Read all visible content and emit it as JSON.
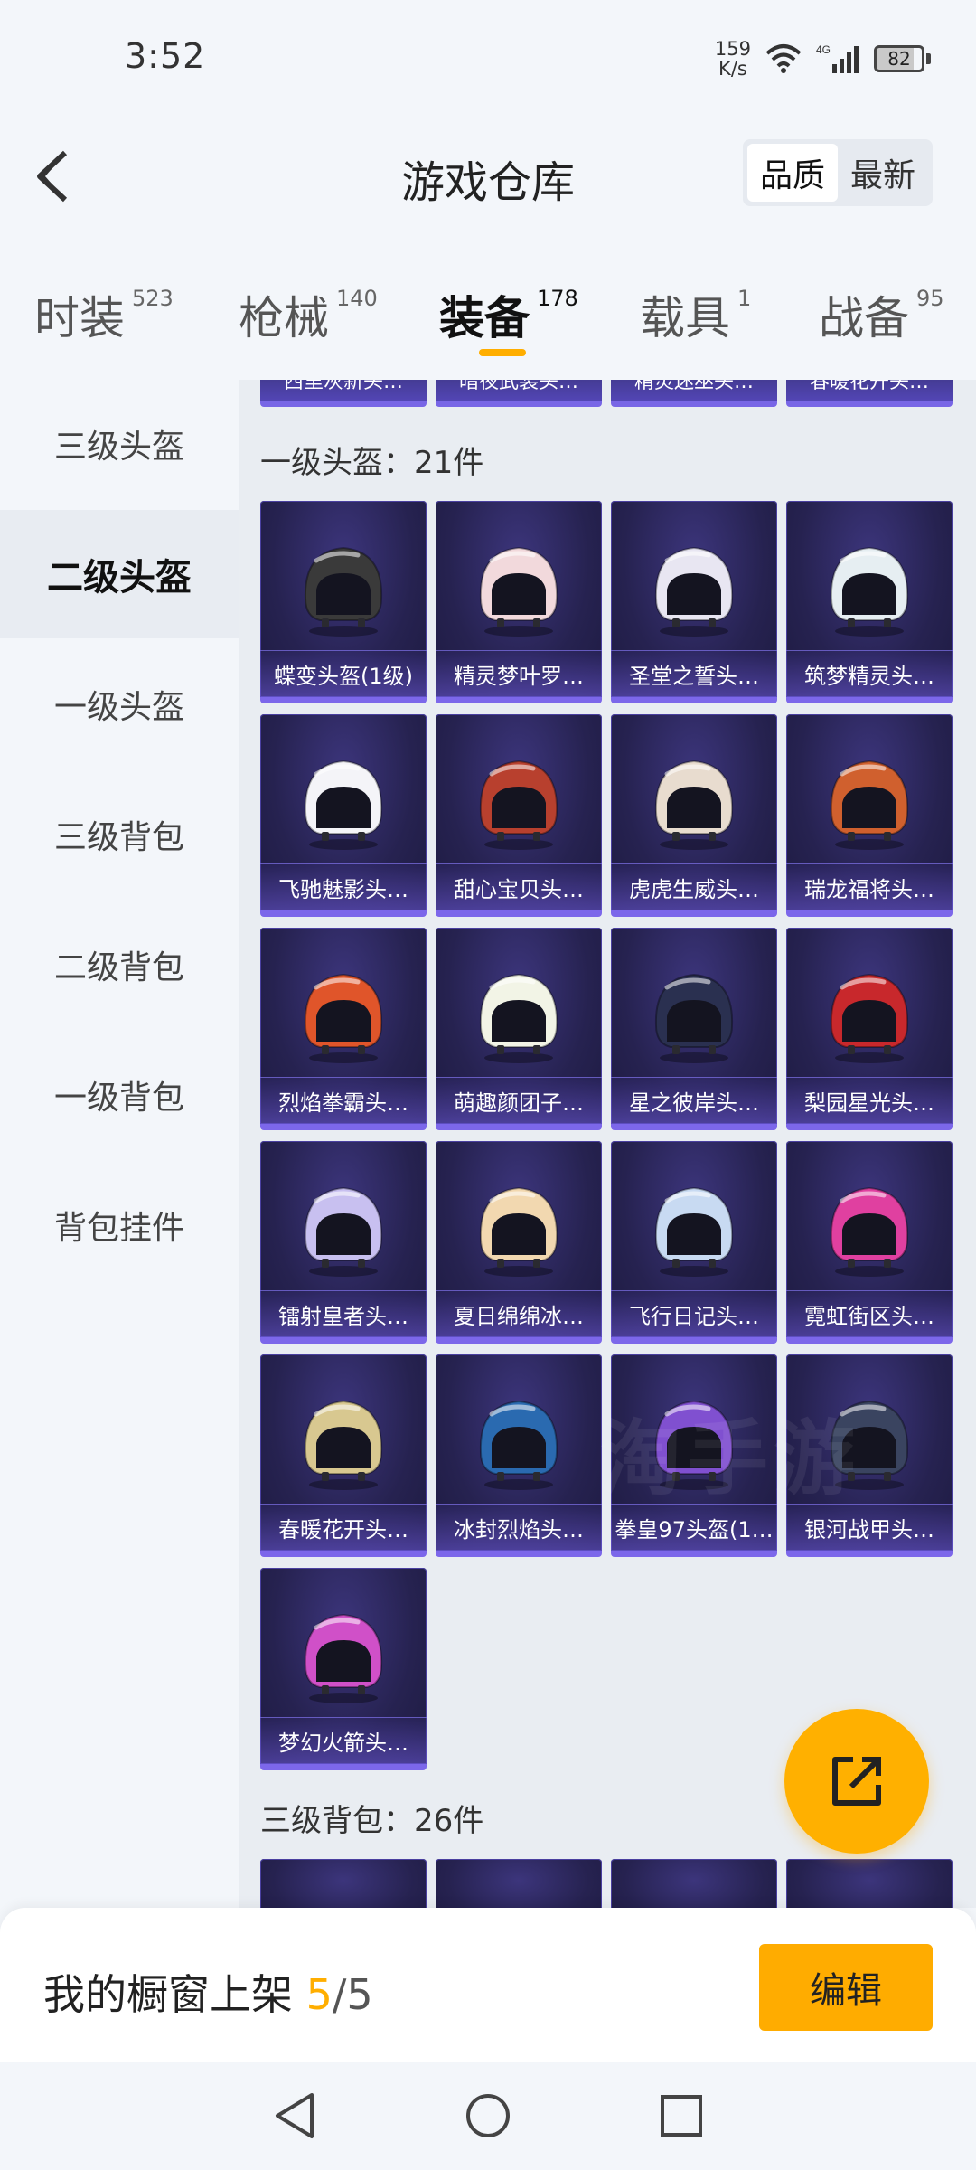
{
  "status": {
    "time": "3:52",
    "net_speed_value": "159",
    "net_speed_unit": "K/s",
    "network": "4G",
    "battery": "82"
  },
  "header": {
    "title": "游戏仓库",
    "sort_options": [
      "品质",
      "最新"
    ],
    "sort_active": "品质"
  },
  "tabs": [
    {
      "label": "时装",
      "count": "523"
    },
    {
      "label": "枪械",
      "count": "140"
    },
    {
      "label": "装备",
      "count": "178"
    },
    {
      "label": "载具",
      "count": "1"
    },
    {
      "label": "战备",
      "count": "95"
    }
  ],
  "active_tab": "装备",
  "sidebar": [
    {
      "label": "三级头盔"
    },
    {
      "label": "二级头盔"
    },
    {
      "label": "一级头盔"
    },
    {
      "label": "三级背包"
    },
    {
      "label": "二级背包"
    },
    {
      "label": "一级背包"
    },
    {
      "label": "背包挂件"
    }
  ],
  "sidebar_active": "二级头盔",
  "partial_top_items": [
    "西里灰新头…",
    "暗夜武装头…",
    "精灵迷巫头…",
    "春暖花开头…"
  ],
  "section_helmet": {
    "title": "一级头盔：21件",
    "items": [
      {
        "name": "蝶变头盔(1级)",
        "color": "#3a3a3a"
      },
      {
        "name": "精灵梦叶罗…",
        "color": "#f2d9dc"
      },
      {
        "name": "圣堂之誓头…",
        "color": "#e8e6f2"
      },
      {
        "name": "筑梦精灵头…",
        "color": "#e6eef2"
      },
      {
        "name": "飞驰魅影头…",
        "color": "#f4f4f8"
      },
      {
        "name": "甜心宝贝头…",
        "color": "#b8402e"
      },
      {
        "name": "虎虎生威头…",
        "color": "#e8dccf"
      },
      {
        "name": "瑞龙福将头…",
        "color": "#d0602e"
      },
      {
        "name": "烈焰拳霸头…",
        "color": "#e0552a"
      },
      {
        "name": "萌趣颜团子…",
        "color": "#f2f4e6"
      },
      {
        "name": "星之彼岸头…",
        "color": "#2a3050"
      },
      {
        "name": "梨园星光头…",
        "color": "#c8282c"
      },
      {
        "name": "镭射皇者头…",
        "color": "#c8c0f0"
      },
      {
        "name": "夏日绵绵冰…",
        "color": "#f2d8b0"
      },
      {
        "name": "飞行日记头…",
        "color": "#c8daf2"
      },
      {
        "name": "霓虹街区头…",
        "color": "#e040a0"
      },
      {
        "name": "春暖花开头…",
        "color": "#d8c890"
      },
      {
        "name": "冰封烈焰头…",
        "color": "#2a6ab0"
      },
      {
        "name": "拳皇97头盔(1…",
        "color": "#8050d0"
      },
      {
        "name": "银河战甲头…",
        "color": "#3a4460"
      },
      {
        "name": "梦幻火箭头…",
        "color": "#d050c8"
      }
    ]
  },
  "section_backpack": {
    "title": "三级背包：26件"
  },
  "watermark": "淘手游",
  "bottom": {
    "shelf_label": "我的橱窗上架",
    "shelf_count": "5",
    "shelf_total": "/5",
    "edit_label": "编辑"
  },
  "colors": {
    "accent": "#ffac00",
    "card_dark": "#262250",
    "card_border": "#7c67ea"
  }
}
